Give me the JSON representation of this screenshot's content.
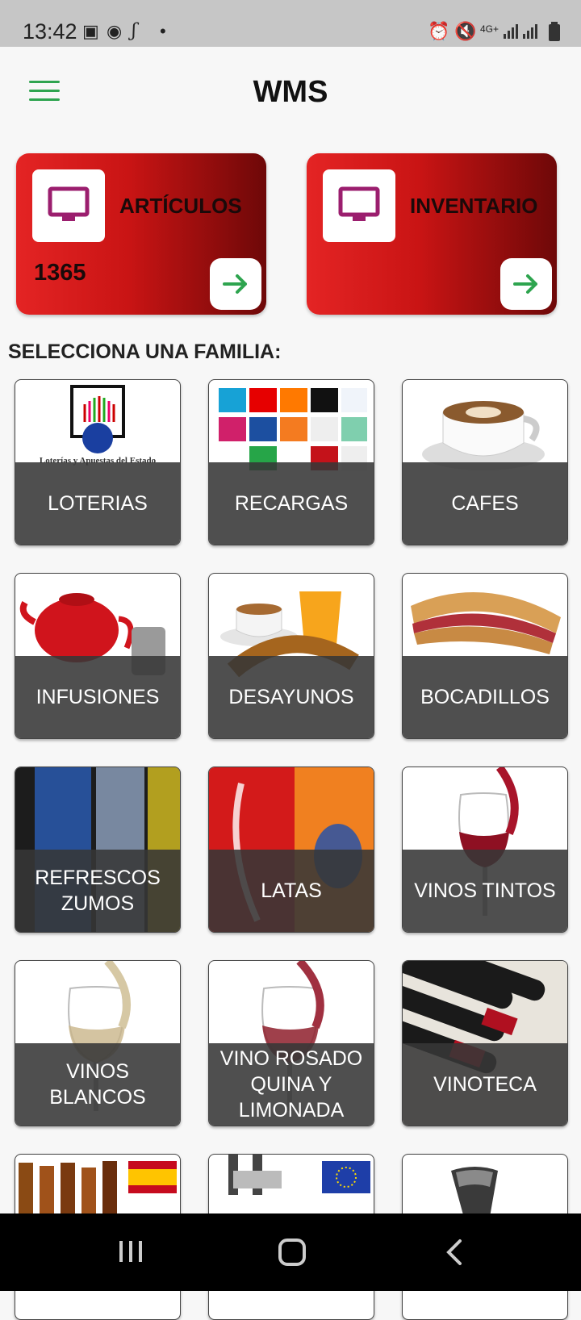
{
  "status_bar": {
    "time": "13:42"
  },
  "app_bar": {
    "title": "WMS"
  },
  "cards": [
    {
      "title": "ARTÍCULOS",
      "count": "1365"
    },
    {
      "title": "INVENTARIO",
      "count": ""
    }
  ],
  "section_title": "SELECCIONA UNA FAMILIA:",
  "families": [
    {
      "label": "LOTERIAS",
      "logo_text": "Loterías y Apuestas del Estado"
    },
    {
      "label": "RECARGAS"
    },
    {
      "label": "CAFES"
    },
    {
      "label": "INFUSIONES"
    },
    {
      "label": "DESAYUNOS"
    },
    {
      "label": "BOCADILLOS"
    },
    {
      "label": "REFRESCOS\nZUMOS"
    },
    {
      "label": "LATAS"
    },
    {
      "label": "VINOS TINTOS"
    },
    {
      "label": "VINOS\nBLANCOS"
    },
    {
      "label": "VINO ROSADO\nQUINA Y\nLIMONADA"
    },
    {
      "label": "VINOTECA"
    }
  ],
  "recarga_logos": [
    "movistar",
    "vodafone",
    "orange",
    "yoigo",
    "PayPal",
    "Carrefour",
    "DIGI",
    "euskaltel",
    "MOBILE",
    "happy",
    "hits",
    "jazz",
    "LCR",
    "Lyca"
  ],
  "colors": {
    "accent_green": "#2ea44f",
    "card_red": "#d41a1a",
    "icon_purple": "#9b1e6e"
  }
}
